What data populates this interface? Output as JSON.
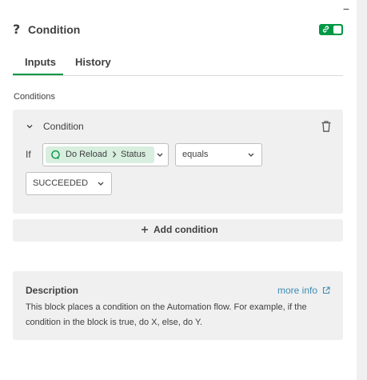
{
  "window": {
    "minimize_label": "−"
  },
  "header": {
    "icon_glyph": "?",
    "title": "Condition"
  },
  "tabs": [
    {
      "label": "Inputs",
      "active": true
    },
    {
      "label": "History",
      "active": false
    }
  ],
  "conditions": {
    "section_label": "Conditions",
    "group_title": "Condition",
    "if_label": "If",
    "variable": {
      "block": "Do Reload",
      "field": "Status"
    },
    "operator": "equals",
    "value": "SUCCEEDED"
  },
  "add_condition": {
    "label": "Add condition"
  },
  "description": {
    "title": "Description",
    "more_info": "more info",
    "text": "This block places a condition on the Automation flow. For example, if the condition in the block is true, do X, else, do Y."
  },
  "colors": {
    "accent": "#009845",
    "chip": "#d8eedf",
    "link": "#3f8ab3",
    "panel_bg": "#f0f0f0"
  },
  "icons": [
    "help-icon",
    "link-icon",
    "chevron-down-icon",
    "trash-icon",
    "reload-icon",
    "chevron-right-icon",
    "plus-icon",
    "external-link-icon"
  ]
}
